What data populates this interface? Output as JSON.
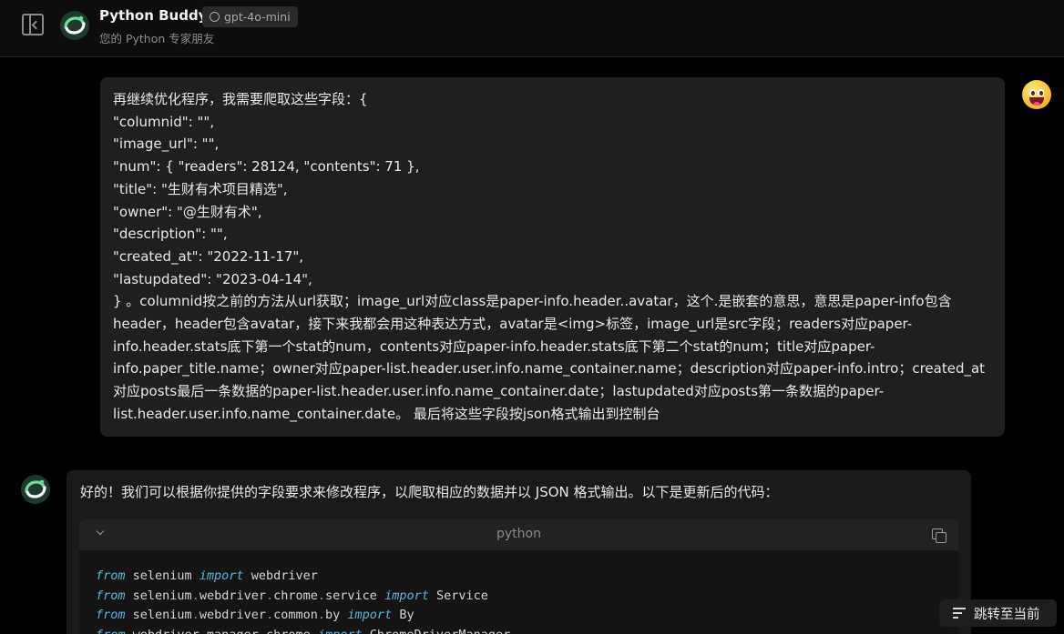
{
  "header": {
    "app_title": "Python Buddy",
    "model_badge": "gpt-4o-mini",
    "subtitle": "您的 Python 专家朋友"
  },
  "user_message": {
    "text": "再继续优化程序，我需要爬取这些字段：{\n\"columnid\": \"\",\n\"image_url\": \"\",\n\"num\": { \"readers\": 28124, \"contents\": 71 },\n\"title\": \"生财有术项目精选\",\n\"owner\": \"@生财有术\",\n\"description\": \"\",\n\"created_at\": \"2022-11-17\",\n\"lastupdated\": \"2023-04-14\",\n} 。columnid按之前的方法从url获取；image_url对应class是paper-info.header..avatar，这个.是嵌套的意思，意思是paper-info包含header，header包含avatar，接下来我都会用这种表达方式，avatar是<img>标签，image_url是src字段；readers对应paper-info.header.stats底下第一个stat的num，contents对应paper-info.header.stats底下第二个stat的num；title对应paper-info.paper_title.name；owner对应paper-list.header.user.info.name_container.name；description对应paper-info.intro；created_at对应posts最后一条数据的paper-list.header.user.info.name_container.date；lastupdated对应posts第一条数据的paper-list.header.user.info.name_container.date。 最后将这些字段按json格式输出到控制台"
  },
  "assistant_message": {
    "text": "好的！我们可以根据你提供的字段要求来修改程序，以爬取相应的数据并以 JSON 格式输出。以下是更新后的代码：",
    "code_language": "python",
    "code_lines": [
      [
        {
          "t": "from",
          "k": 1
        },
        {
          "t": " selenium "
        },
        {
          "t": "import",
          "k": 1
        },
        {
          "t": " webdriver"
        }
      ],
      [
        {
          "t": "from",
          "k": 1
        },
        {
          "t": " selenium"
        },
        {
          "t": ".",
          "d": 1
        },
        {
          "t": "webdriver"
        },
        {
          "t": ".",
          "d": 1
        },
        {
          "t": "chrome"
        },
        {
          "t": ".",
          "d": 1
        },
        {
          "t": "service "
        },
        {
          "t": "import",
          "k": 1
        },
        {
          "t": " Service"
        }
      ],
      [
        {
          "t": "from",
          "k": 1
        },
        {
          "t": " selenium"
        },
        {
          "t": ".",
          "d": 1
        },
        {
          "t": "webdriver"
        },
        {
          "t": ".",
          "d": 1
        },
        {
          "t": "common"
        },
        {
          "t": ".",
          "d": 1
        },
        {
          "t": "by "
        },
        {
          "t": "import",
          "k": 1
        },
        {
          "t": " By"
        }
      ],
      [
        {
          "t": "from",
          "k": 1
        },
        {
          "t": " webdriver_manager"
        },
        {
          "t": ".",
          "d": 1
        },
        {
          "t": "chrome "
        },
        {
          "t": "import",
          "k": 1
        },
        {
          "t": " ChromeDriverManager"
        }
      ]
    ]
  },
  "jump_button": {
    "label": "跳转至当前"
  }
}
